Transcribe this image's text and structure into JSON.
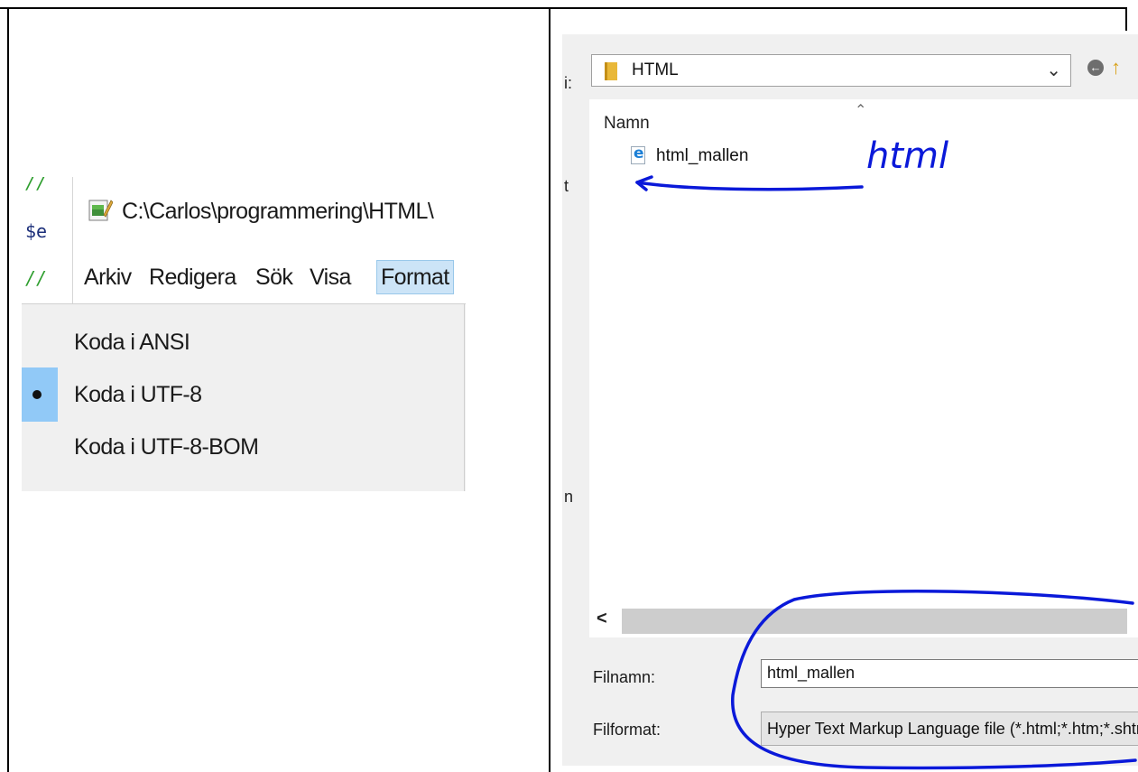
{
  "notepad": {
    "code_lines": [
      "//",
      "$e",
      "//"
    ],
    "title": "C:\\Carlos\\programmering\\HTML\\",
    "menu": [
      {
        "label": "Arkiv"
      },
      {
        "label": "Redigera"
      },
      {
        "label": "Sök"
      },
      {
        "label": "Visa"
      },
      {
        "label": "Format",
        "active": true
      }
    ],
    "format_menu": {
      "items": [
        {
          "label": "Koda i ANSI",
          "checked": false
        },
        {
          "label": "Koda i UTF-8",
          "checked": true
        },
        {
          "label": "Koda i UTF-8-BOM",
          "checked": false
        }
      ]
    }
  },
  "save_dialog": {
    "side_fragments": [
      "i:",
      "t",
      "n"
    ],
    "folder": "HTML",
    "column_header": "Namn",
    "files": [
      {
        "name": "html_mallen",
        "icon": "internet-explorer-html-icon"
      }
    ],
    "filename_label": "Filnamn:",
    "filename_value": "html_mallen",
    "filetype_label": "Filformat:",
    "filetype_value": "Hyper Text Markup Language file (*.html;*.htm;*.shtml;*.shtm;*.xhtml;*.xht;*.hta)"
  },
  "annotation": {
    "handwritten": "html",
    "ink_color": "#0a19d9"
  }
}
